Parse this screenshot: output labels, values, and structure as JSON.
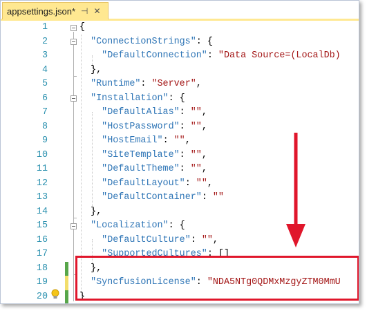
{
  "tab": {
    "title": "appsettings.json*",
    "pin_glyph": "⊣",
    "close_glyph": "✕"
  },
  "lines": [
    {
      "n": "1",
      "parts": [
        [
          "p",
          "{"
        ]
      ]
    },
    {
      "n": "2",
      "parts": [
        [
          "p",
          "  "
        ],
        [
          "k",
          "\"ConnectionStrings\""
        ],
        [
          "p",
          ": {"
        ]
      ]
    },
    {
      "n": "3",
      "parts": [
        [
          "p",
          "    "
        ],
        [
          "k",
          "\"DefaultConnection\""
        ],
        [
          "p",
          ": "
        ],
        [
          "s",
          "\"Data Source=(LocalDb)"
        ]
      ]
    },
    {
      "n": "4",
      "parts": [
        [
          "p",
          "  },"
        ]
      ]
    },
    {
      "n": "5",
      "parts": [
        [
          "p",
          "  "
        ],
        [
          "k",
          "\"Runtime\""
        ],
        [
          "p",
          ": "
        ],
        [
          "s",
          "\"Server\""
        ],
        [
          "p",
          ","
        ]
      ]
    },
    {
      "n": "6",
      "parts": [
        [
          "p",
          "  "
        ],
        [
          "k",
          "\"Installation\""
        ],
        [
          "p",
          ": {"
        ]
      ]
    },
    {
      "n": "7",
      "parts": [
        [
          "p",
          "    "
        ],
        [
          "k",
          "\"DefaultAlias\""
        ],
        [
          "p",
          ": "
        ],
        [
          "s",
          "\"\""
        ],
        [
          "p",
          ","
        ]
      ]
    },
    {
      "n": "8",
      "parts": [
        [
          "p",
          "    "
        ],
        [
          "k",
          "\"HostPassword\""
        ],
        [
          "p",
          ": "
        ],
        [
          "s",
          "\"\""
        ],
        [
          "p",
          ","
        ]
      ]
    },
    {
      "n": "9",
      "parts": [
        [
          "p",
          "    "
        ],
        [
          "k",
          "\"HostEmail\""
        ],
        [
          "p",
          ": "
        ],
        [
          "s",
          "\"\""
        ],
        [
          "p",
          ","
        ]
      ]
    },
    {
      "n": "10",
      "parts": [
        [
          "p",
          "    "
        ],
        [
          "k",
          "\"SiteTemplate\""
        ],
        [
          "p",
          ": "
        ],
        [
          "s",
          "\"\""
        ],
        [
          "p",
          ","
        ]
      ]
    },
    {
      "n": "11",
      "parts": [
        [
          "p",
          "    "
        ],
        [
          "k",
          "\"DefaultTheme\""
        ],
        [
          "p",
          ": "
        ],
        [
          "s",
          "\"\""
        ],
        [
          "p",
          ","
        ]
      ]
    },
    {
      "n": "12",
      "parts": [
        [
          "p",
          "    "
        ],
        [
          "k",
          "\"DefaultLayout\""
        ],
        [
          "p",
          ": "
        ],
        [
          "s",
          "\"\""
        ],
        [
          "p",
          ","
        ]
      ]
    },
    {
      "n": "13",
      "parts": [
        [
          "p",
          "    "
        ],
        [
          "k",
          "\"DefaultContainer\""
        ],
        [
          "p",
          ": "
        ],
        [
          "s",
          "\"\""
        ]
      ]
    },
    {
      "n": "14",
      "parts": [
        [
          "p",
          "  },"
        ]
      ]
    },
    {
      "n": "15",
      "parts": [
        [
          "p",
          "  "
        ],
        [
          "k",
          "\"Localization\""
        ],
        [
          "p",
          ": {"
        ]
      ]
    },
    {
      "n": "16",
      "parts": [
        [
          "p",
          "    "
        ],
        [
          "k",
          "\"DefaultCulture\""
        ],
        [
          "p",
          ": "
        ],
        [
          "s",
          "\"\""
        ],
        [
          "p",
          ","
        ]
      ]
    },
    {
      "n": "17",
      "parts": [
        [
          "p",
          "    "
        ],
        [
          "k",
          "\"SupportedCultures\""
        ],
        [
          "p",
          ": []"
        ]
      ]
    },
    {
      "n": "18",
      "parts": [
        [
          "p",
          "  },"
        ]
      ]
    },
    {
      "n": "19",
      "parts": [
        [
          "p",
          "  "
        ],
        [
          "k",
          "\"SyncfusionLicense\""
        ],
        [
          "p",
          ": "
        ],
        [
          "s",
          "\"NDA5NTg0QDMxMzgyZTM0MmU"
        ]
      ]
    },
    {
      "n": "20",
      "parts": [
        [
          "p",
          "}"
        ]
      ]
    }
  ],
  "change_markers": {
    "18": "saved",
    "19": "unsaved",
    "20": "saved"
  },
  "colors": {
    "line_number": "#2b91af",
    "json_key": "#2e75b6",
    "json_string": "#a31515",
    "tab_active": "#ffe891",
    "change_saved": "#57a64a",
    "change_unsaved": "#f2de6b",
    "annotation": "#e0162b"
  },
  "icons": {
    "lightbulb": "lightbulb-icon",
    "collapse": "collapse-minus-icon"
  }
}
